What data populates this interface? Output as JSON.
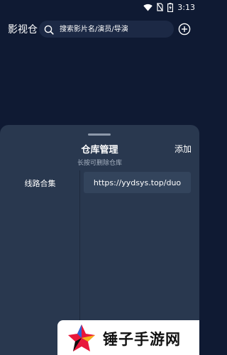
{
  "status_bar": {
    "time": "3:13",
    "icons": [
      "wifi-icon",
      "no-sim-icon",
      "battery-charging-icon"
    ]
  },
  "header": {
    "app_title": "影视仓",
    "search_placeholder": "搜索影片名/演员/导演",
    "add_icon": "plus-circle-icon"
  },
  "sheet": {
    "title": "仓库管理",
    "subtitle": "长按可删除仓库",
    "add_label": "添加",
    "groups": [
      {
        "label": "线路合集"
      }
    ],
    "urls": [
      {
        "label": "https://yydsys.top/duo"
      }
    ]
  },
  "watermark": {
    "text": "锤子手游网"
  },
  "colors": {
    "background": "#0f1a33",
    "sheet": "#29384f",
    "item": "#33445c",
    "accent": "#e8173b"
  }
}
